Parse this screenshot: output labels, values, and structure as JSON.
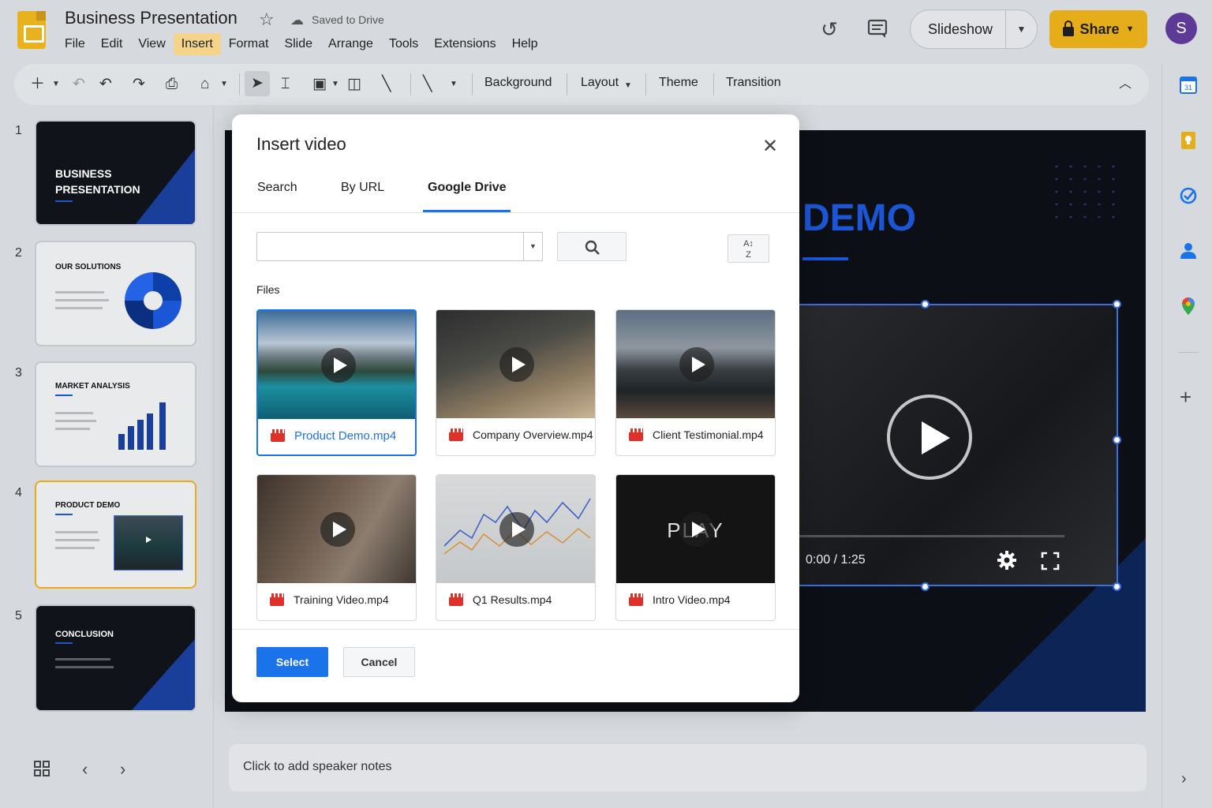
{
  "header": {
    "title": "Business Presentation",
    "saved_status": "Saved to Drive",
    "menu": [
      "File",
      "Edit",
      "View",
      "Insert",
      "Format",
      "Slide",
      "Arrange",
      "Tools",
      "Extensions",
      "Help"
    ],
    "active_menu": "Insert",
    "slideshow_label": "Slideshow",
    "share_label": "Share",
    "avatar_initial": "S"
  },
  "toolbar": {
    "background_label": "Background",
    "layout_label": "Layout",
    "theme_label": "Theme",
    "transition_label": "Transition"
  },
  "filmstrip": {
    "slides": [
      {
        "number": "1",
        "title_line1": "BUSINESS",
        "title_line2": "PRESENTATION"
      },
      {
        "number": "2",
        "title": "OUR SOLUTIONS"
      },
      {
        "number": "3",
        "title": "MARKET ANALYSIS"
      },
      {
        "number": "4",
        "title": "PRODUCT DEMO"
      },
      {
        "number": "5",
        "title": "CONCLUSION"
      }
    ],
    "selected_index": 4
  },
  "slide": {
    "title_visible": "DEMO",
    "video_time": "0:00 / 1:25",
    "video_progress": 0.05
  },
  "notes": {
    "placeholder": "Click to add speaker notes"
  },
  "modal": {
    "title": "Insert video",
    "tabs": [
      "Search",
      "By URL",
      "Google Drive"
    ],
    "active_tab": "Google Drive",
    "search_value": "",
    "files_label": "Files",
    "files": [
      {
        "name": "Product Demo.mp4",
        "selected": true
      },
      {
        "name": "Company Overview.mp4",
        "selected": false
      },
      {
        "name": "Client Testimonial.mp4",
        "selected": false
      },
      {
        "name": "Training Video.mp4",
        "selected": false
      },
      {
        "name": "Q1 Results.mp4",
        "selected": false
      },
      {
        "name": "Intro Video.mp4",
        "selected": false,
        "overlay_text": "PLAY"
      }
    ],
    "select_label": "Select",
    "cancel_label": "Cancel"
  },
  "colors": {
    "accent_blue": "#1a73e8",
    "share_yellow": "#e5ad1a",
    "slide_blue": "#1a56d6",
    "avatar_purple": "#5d3a96"
  },
  "icons": [
    "star-icon",
    "cloud-icon",
    "history-icon",
    "comment-icon",
    "lock-icon",
    "close-icon",
    "search-icon",
    "sort-icon",
    "play-icon",
    "volume-icon",
    "settings-icon",
    "fullscreen-icon",
    "grid-view-icon",
    "chevron-left-icon",
    "chevron-right-icon",
    "calendar-icon",
    "keep-icon",
    "tasks-icon",
    "contacts-icon",
    "maps-icon",
    "plus-icon"
  ]
}
